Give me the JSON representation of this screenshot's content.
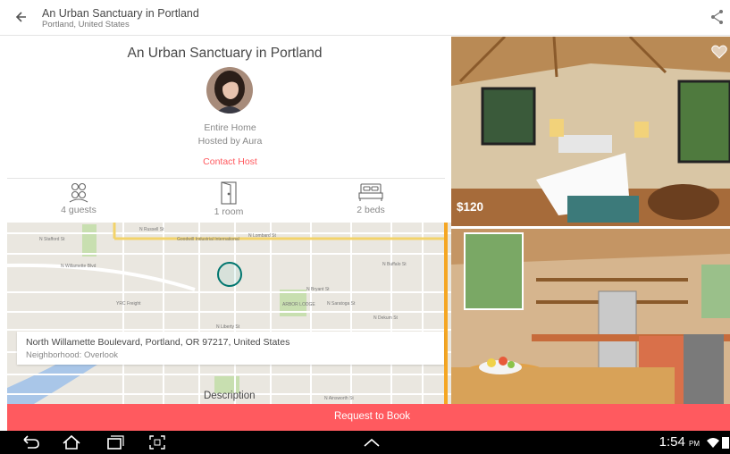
{
  "header": {
    "title": "An Urban Sanctuary in Portland",
    "subtitle": "Portland, United States"
  },
  "listing": {
    "title": "An Urban Sanctuary in Portland",
    "room_type": "Entire Home",
    "host_line": "Hosted by Aura",
    "contact_label": "Contact Host",
    "amenities": [
      {
        "icon": "guests-icon",
        "label": "4 guests"
      },
      {
        "icon": "door-icon",
        "label": "1 room"
      },
      {
        "icon": "bed-icon",
        "label": "2 beds"
      }
    ]
  },
  "map": {
    "streets": [
      "N Russell St",
      "N Stafford St",
      "N Lombard St",
      "N Willamette Blvd",
      "N Bryant St",
      "N Saratoga St",
      "N Dekum St",
      "N Liberty St",
      "N Ainsworth St",
      "N Buffalo St",
      "Goodwill Industrial International",
      "YRC Freight",
      "ARBOR LODGE"
    ],
    "address": "North Willamette Boulevard, Portland, OR 97217, United States",
    "neighborhood": "Neighborhood: Overlook"
  },
  "description_label": "Description",
  "photos": {
    "price": "$120"
  },
  "book_label": "Request to Book",
  "status": {
    "time": "1:54",
    "ampm": "PM"
  },
  "colors": {
    "brand": "#ff5a5f",
    "map_accent": "#f5a623"
  }
}
